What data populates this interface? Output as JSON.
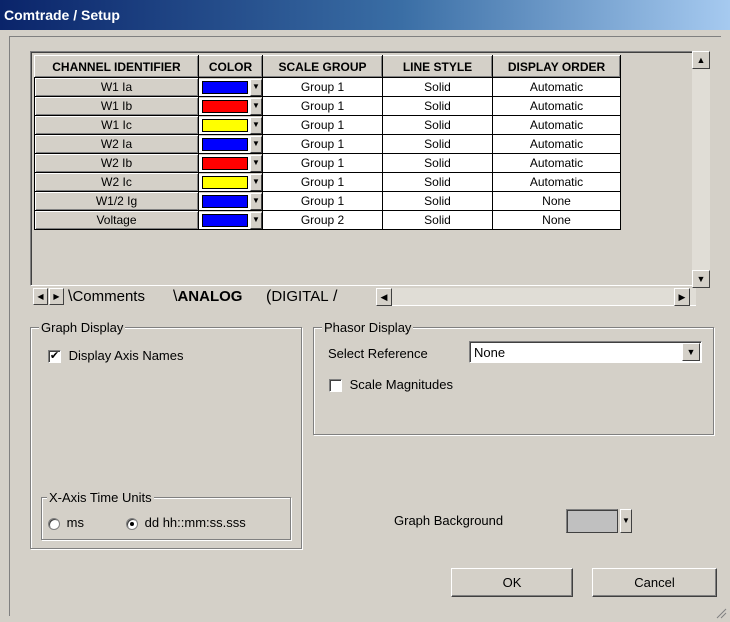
{
  "window": {
    "title": "Comtrade / Setup"
  },
  "grid": {
    "headers": [
      "CHANNEL IDENTIFIER",
      "COLOR",
      "SCALE GROUP",
      "LINE STYLE",
      "DISPLAY ORDER"
    ],
    "rows": [
      {
        "channel": "W1 Ia",
        "color": "#0000ff",
        "group": "Group 1",
        "style": "Solid",
        "order": "Automatic"
      },
      {
        "channel": "W1 Ib",
        "color": "#ff0000",
        "group": "Group 1",
        "style": "Solid",
        "order": "Automatic"
      },
      {
        "channel": "W1 Ic",
        "color": "#ffff00",
        "group": "Group 1",
        "style": "Solid",
        "order": "Automatic"
      },
      {
        "channel": "W2 Ia",
        "color": "#0000ff",
        "group": "Group 1",
        "style": "Solid",
        "order": "Automatic"
      },
      {
        "channel": "W2 Ib",
        "color": "#ff0000",
        "group": "Group 1",
        "style": "Solid",
        "order": "Automatic"
      },
      {
        "channel": "W2 Ic",
        "color": "#ffff00",
        "group": "Group 1",
        "style": "Solid",
        "order": "Automatic"
      },
      {
        "channel": "W1/2 Ig",
        "color": "#0000ff",
        "group": "Group 1",
        "style": "Solid",
        "order": "None"
      },
      {
        "channel": "Voltage",
        "color": "#0000ff",
        "group": "Group 2",
        "style": "Solid",
        "order": "None"
      }
    ]
  },
  "tabs": {
    "items": [
      {
        "label": "Comments"
      },
      {
        "label": "ANALOG"
      },
      {
        "label": "DIGITAL"
      }
    ],
    "active": "ANALOG"
  },
  "graph_display": {
    "legend": "Graph Display",
    "axis_names_label": "Display Axis Names",
    "axis_names_checked": true,
    "time_units": {
      "legend": "X-Axis Time Units",
      "option_ms": "ms",
      "option_dd": "dd hh::mm:ss.sss",
      "selected": "dd"
    }
  },
  "phasor_display": {
    "legend": "Phasor Display",
    "select_reference_label": "Select Reference",
    "select_reference_value": "None",
    "scale_magnitudes_label": "Scale Magnitudes",
    "scale_magnitudes_checked": false
  },
  "graph_background": {
    "label": "Graph Background",
    "color": "#c0c0c0"
  },
  "buttons": {
    "ok": "OK",
    "cancel": "Cancel"
  }
}
